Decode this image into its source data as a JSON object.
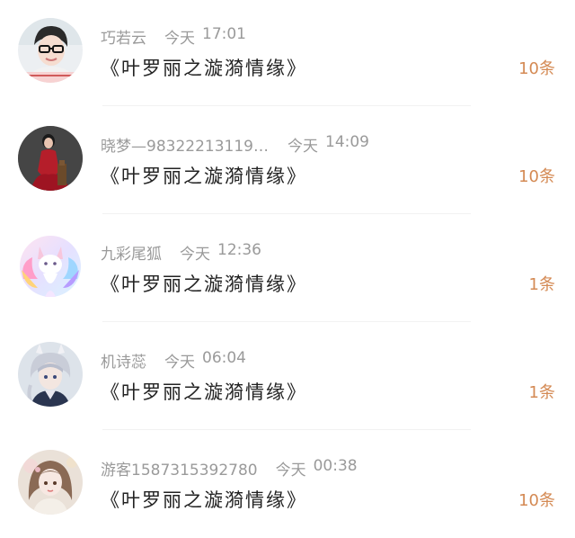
{
  "colors": {
    "name_gray": "#9a9a9a",
    "title_dark": "#222222",
    "count_orange": "#d48a54"
  },
  "items": [
    {
      "name": "巧若云",
      "day": "今天",
      "time": "17:01",
      "title": "《叶罗丽之漩漪情缘》",
      "count": "10条",
      "avatar_icon": "avatar-girl-glasses-icon"
    },
    {
      "name": "晓梦—983222131193…",
      "day": "今天",
      "time": "14:09",
      "title": "《叶罗丽之漩漪情缘》",
      "count": "10条",
      "avatar_icon": "avatar-woman-red-dress-icon"
    },
    {
      "name": "九彩尾狐",
      "day": "今天",
      "time": "12:36",
      "title": "《叶罗丽之漩漪情缘》",
      "count": "1条",
      "avatar_icon": "avatar-fox-icon"
    },
    {
      "name": "机诗蕊",
      "day": "今天",
      "time": "06:04",
      "title": "《叶罗丽之漩漪情缘》",
      "count": "1条",
      "avatar_icon": "avatar-anime-boy-icon"
    },
    {
      "name": "游客1587315392780",
      "day": "今天",
      "time": "00:38",
      "title": "《叶罗丽之漩漪情缘》",
      "count": "10条",
      "avatar_icon": "avatar-anime-girl-icon"
    }
  ]
}
